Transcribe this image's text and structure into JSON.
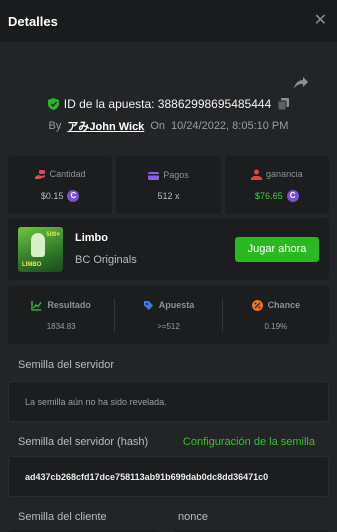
{
  "header": {
    "title": "Detalles"
  },
  "bet": {
    "id_label": "ID de la apuesta: 38862998695485444",
    "by_label": "By",
    "user": "アみJohn Wick",
    "on_label": "On",
    "datetime": "10/24/2022, 8:05:10 PM"
  },
  "stats": {
    "amount": {
      "label": "Cantidad",
      "value": "$0.15"
    },
    "payout": {
      "label": "Pagos",
      "value": "512 x"
    },
    "profit": {
      "label": "ganancia",
      "value": "$76.65"
    }
  },
  "game": {
    "name": "Limbo",
    "provider": "BC Originals",
    "play_label": "Jugar ahora",
    "thumb_mult": "500×",
    "thumb_name": "LIMBO"
  },
  "result": {
    "result": {
      "label": "Resultado",
      "value": "1834.83"
    },
    "bet": {
      "label": "Apuesta",
      "value": ">=512"
    },
    "chance": {
      "label": "Chance",
      "value": "0.19%"
    }
  },
  "seeds": {
    "server_label": "Semilla del servidor",
    "server_value": "La semilla aún no ha sido revelada.",
    "hash_label": "Semilla del servidor (hash)",
    "config_label": "Configuración de la semilla",
    "hash_value": "ad437cb268cfd17dce758113ab91b699dab0dc8dd36471c0",
    "client_label": "Semilla del cliente",
    "nonce_label": "nonce"
  },
  "colors": {
    "accent_green": "#29b81f",
    "profit_green": "#3fd43f",
    "coin_purple": "#7b4fd6"
  }
}
